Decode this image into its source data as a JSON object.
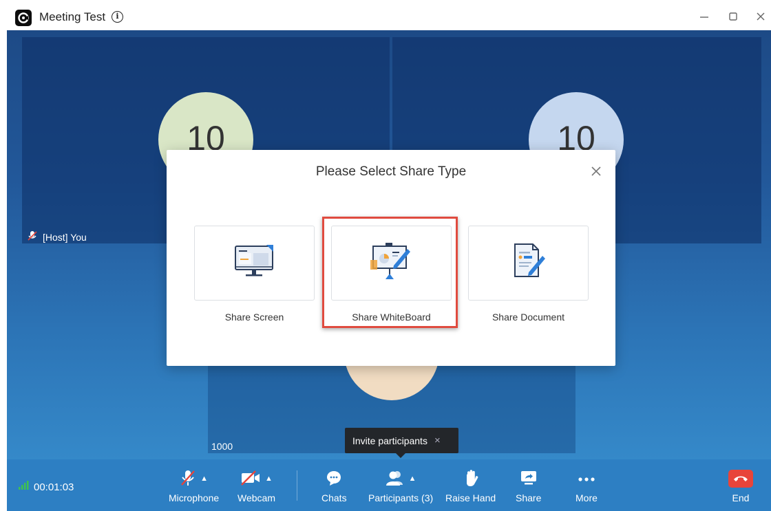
{
  "window": {
    "title": "Meeting Test",
    "info_icon": "info-icon",
    "controls": [
      "minimize-icon",
      "maximize-icon",
      "close-icon"
    ]
  },
  "tiles": [
    {
      "avatar_text": "10",
      "label": "[Host] You",
      "muted": true
    },
    {
      "avatar_text": "10",
      "label": ""
    },
    {
      "avatar_text": "",
      "label": "1000"
    }
  ],
  "dialog": {
    "title": "Please Select Share Type",
    "options": [
      {
        "label": "Share Screen",
        "icon": "monitor-icon",
        "selected": false
      },
      {
        "label": "Share WhiteBoard",
        "icon": "whiteboard-icon",
        "selected": true
      },
      {
        "label": "Share Document",
        "icon": "document-icon",
        "selected": false
      }
    ]
  },
  "tooltip": {
    "text": "Invite participants",
    "close_glyph": "×"
  },
  "toolbar": {
    "duration": "00:01:03",
    "microphone": "Microphone",
    "webcam": "Webcam",
    "chats": "Chats",
    "participants": "Participants (3)",
    "raise_hand": "Raise Hand",
    "share": "Share",
    "more": "More",
    "end": "End"
  },
  "colors": {
    "toolbar_bg": "#2d7fc3",
    "end_red": "#e8443a",
    "highlight_red": "#e04b3f",
    "signal_green": "#3fc24f"
  }
}
